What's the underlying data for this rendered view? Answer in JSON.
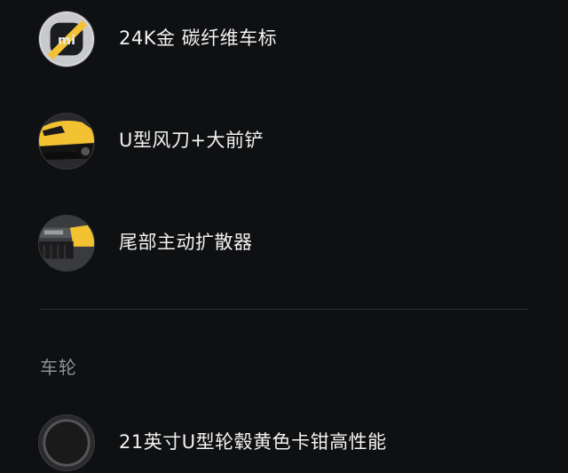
{
  "items": [
    {
      "label": "24K金 碳纤维车标",
      "icon": "gold-carbon-badge-icon"
    },
    {
      "label": "U型风刀+大前铲",
      "icon": "yellow-car-front-icon"
    },
    {
      "label": "尾部主动扩散器",
      "icon": "rear-diffuser-icon"
    }
  ],
  "section": {
    "title": "车轮"
  },
  "partial_item": {
    "label": "21英寸U型轮毂黄色卡钳高性能",
    "icon": "wheel-icon"
  },
  "colors": {
    "background": "#0f1012",
    "accent_yellow": "#f2c232",
    "text_primary": "#f2f2f2",
    "text_secondary": "#8e8f94"
  }
}
